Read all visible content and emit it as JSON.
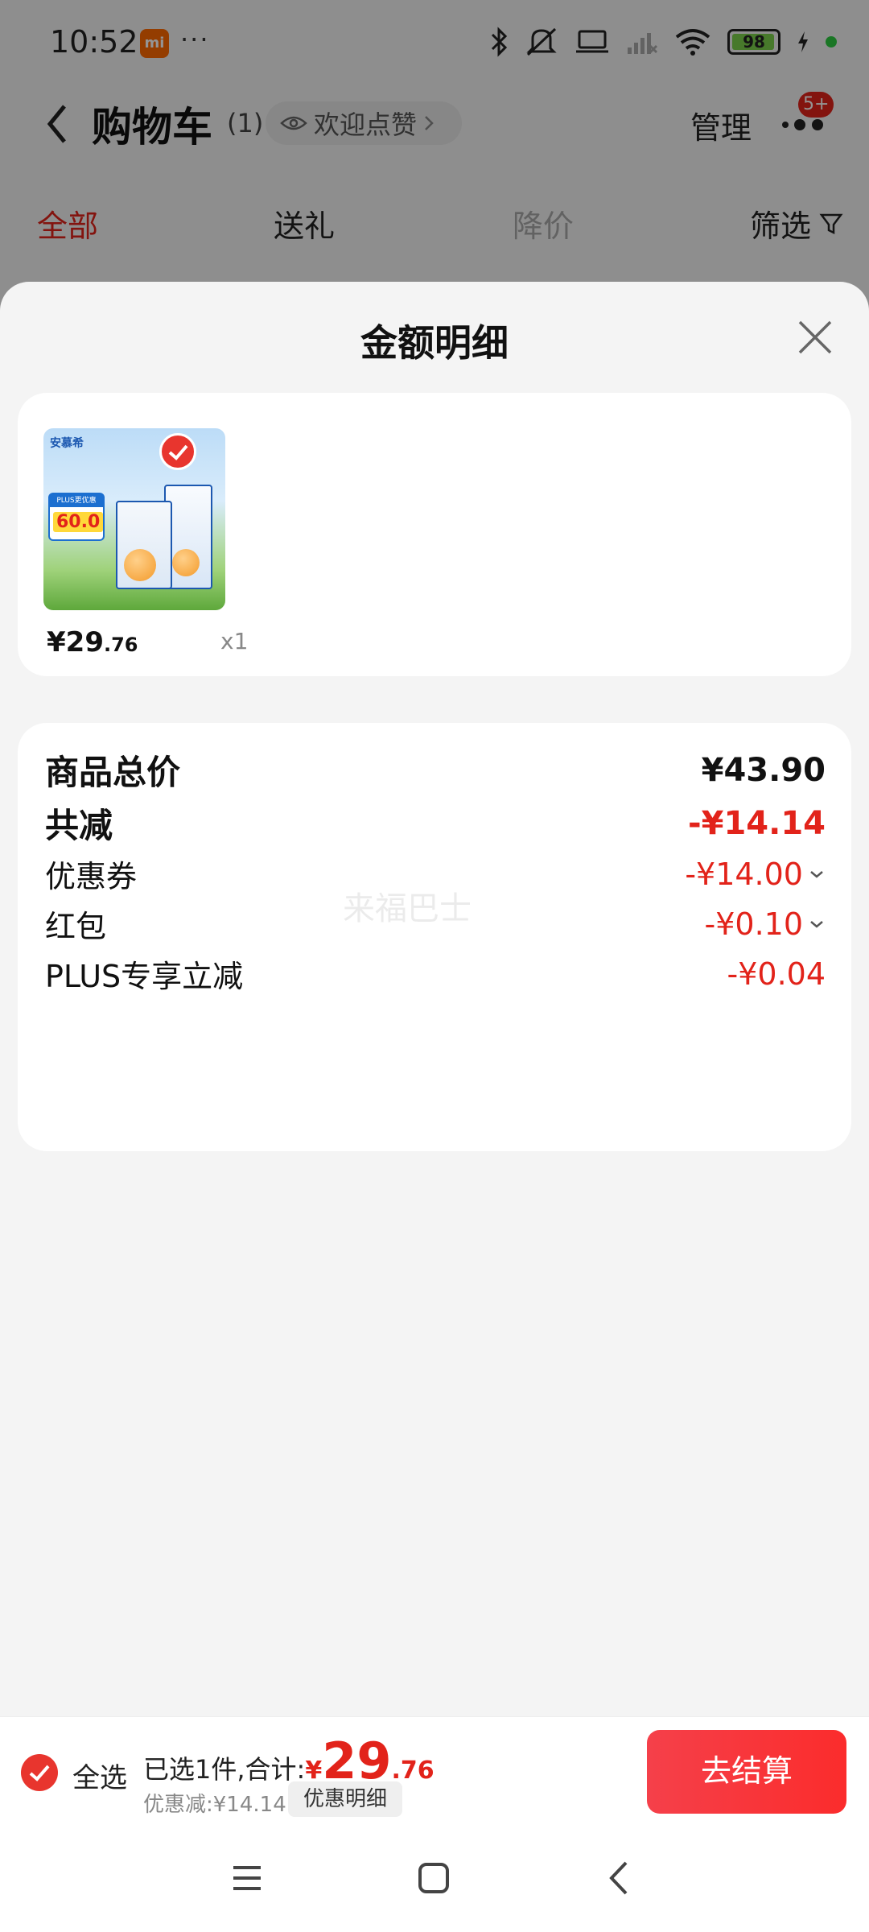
{
  "status_bar": {
    "time": "10:52",
    "mi_badge": "mi",
    "more": "···",
    "battery": "98",
    "icons": [
      "bluetooth-icon",
      "mute-icon",
      "laptop-icon",
      "signal-icon",
      "wifi-icon",
      "battery-icon",
      "charging-icon"
    ]
  },
  "nav": {
    "title": "购物车",
    "count": "(1)",
    "like_chip": "欢迎点赞",
    "manage": "管理",
    "badge": "5+"
  },
  "tabs": [
    {
      "label": "全部",
      "active": true
    },
    {
      "label": "送礼",
      "active": false
    },
    {
      "label": "降价",
      "active": false
    },
    {
      "label": "筛选",
      "active": false
    }
  ],
  "sheet": {
    "title": "金额明细",
    "product": {
      "price_int": "¥29",
      "price_dec": ".76",
      "qty": "x1",
      "image_text": {
        "brand": "安慕希",
        "plus_label": "PLUS更优惠",
        "price_tag": "60.0"
      }
    },
    "details": {
      "total_label": "商品总价",
      "total_value": "¥43.90",
      "reduce_label": "共减",
      "reduce_value": "-¥14.14",
      "coupon_label": "优惠券",
      "coupon_value": "-¥14.00",
      "redpacket_label": "红包",
      "redpacket_value": "-¥0.10",
      "plus_label": "PLUS专享立减",
      "plus_value": "-¥0.04",
      "watermark": "来福巴士"
    }
  },
  "bottom_bar": {
    "select_all": "全选",
    "summary_label": "已选1件,合计:",
    "sum_yen": "¥",
    "sum_int": "29",
    "sum_dec": ".76",
    "discount": "优惠减:¥14.14",
    "detail_chip": "优惠明细",
    "checkout": "去结算"
  },
  "colors": {
    "accent": "#e2231a",
    "checkout": "#fb2c2c",
    "inactive_tab": "#aaaaaa"
  }
}
